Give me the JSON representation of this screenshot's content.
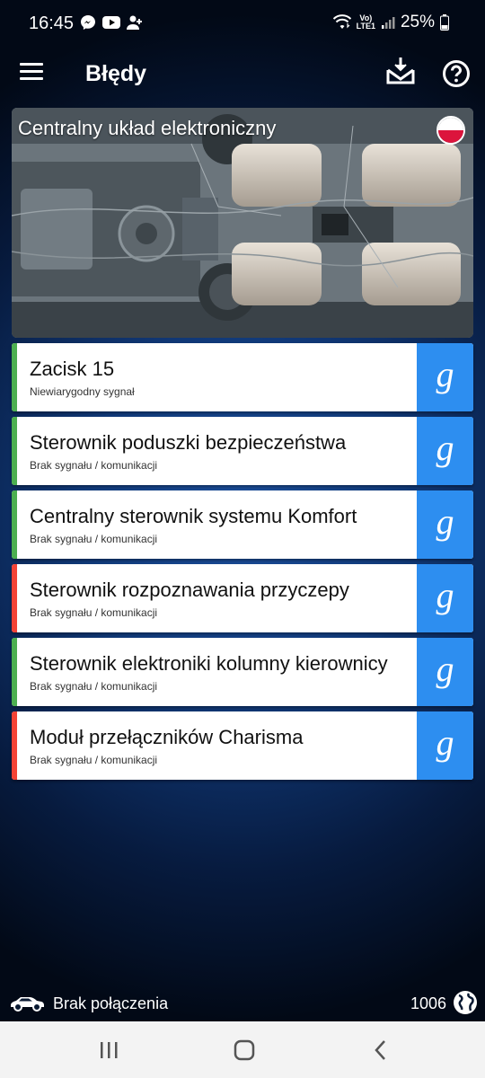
{
  "status_bar": {
    "time": "16:45",
    "battery_percent": "25%",
    "volte_label_1": "Vo)",
    "volte_label_2": "LTE1",
    "icons_left": [
      "messenger-icon",
      "youtube-icon",
      "add-person-icon"
    ],
    "icons_right": [
      "wifi-icon",
      "volte-icon",
      "signal-icon",
      "battery-icon"
    ]
  },
  "app_bar": {
    "title": "Błędy",
    "icons": [
      "menu-icon",
      "download-tray-icon",
      "help-icon"
    ]
  },
  "banner": {
    "title": "Centralny układ elektroniczny",
    "flag": "poland-flag"
  },
  "colors": {
    "ok_stripe": "#4caf50",
    "error_stripe": "#f44336",
    "google_button": "#2d8ef0",
    "background_center": "#1c4f9c"
  },
  "faults": [
    {
      "name": "Zacisk 15",
      "description": "Niewiarygodny sygnał",
      "status": "ok",
      "button_label": "g"
    },
    {
      "name": "Sterownik poduszki bezpieczeństwa",
      "description": "Brak sygnału / komunikacji",
      "status": "ok",
      "button_label": "g"
    },
    {
      "name": "Centralny sterownik systemu Komfort",
      "description": "Brak sygnału / komunikacji",
      "status": "ok",
      "button_label": "g"
    },
    {
      "name": "Sterownik rozpoznawania przyczepy",
      "description": "Brak sygnału / komunikacji",
      "status": "error",
      "button_label": "g"
    },
    {
      "name": "Sterownik elektroniki kolumny kierownicy",
      "description": "Brak sygnału / komunikacji",
      "status": "ok",
      "button_label": "g"
    },
    {
      "name": "Moduł przełączników Charisma",
      "description": "Brak sygnału / komunikacji",
      "status": "error",
      "button_label": "g"
    }
  ],
  "bottom_status": {
    "connection_text": "Brak połączenia",
    "count": "1006"
  },
  "nav_bar": {
    "buttons": [
      "recents-icon",
      "home-icon",
      "back-icon"
    ]
  }
}
